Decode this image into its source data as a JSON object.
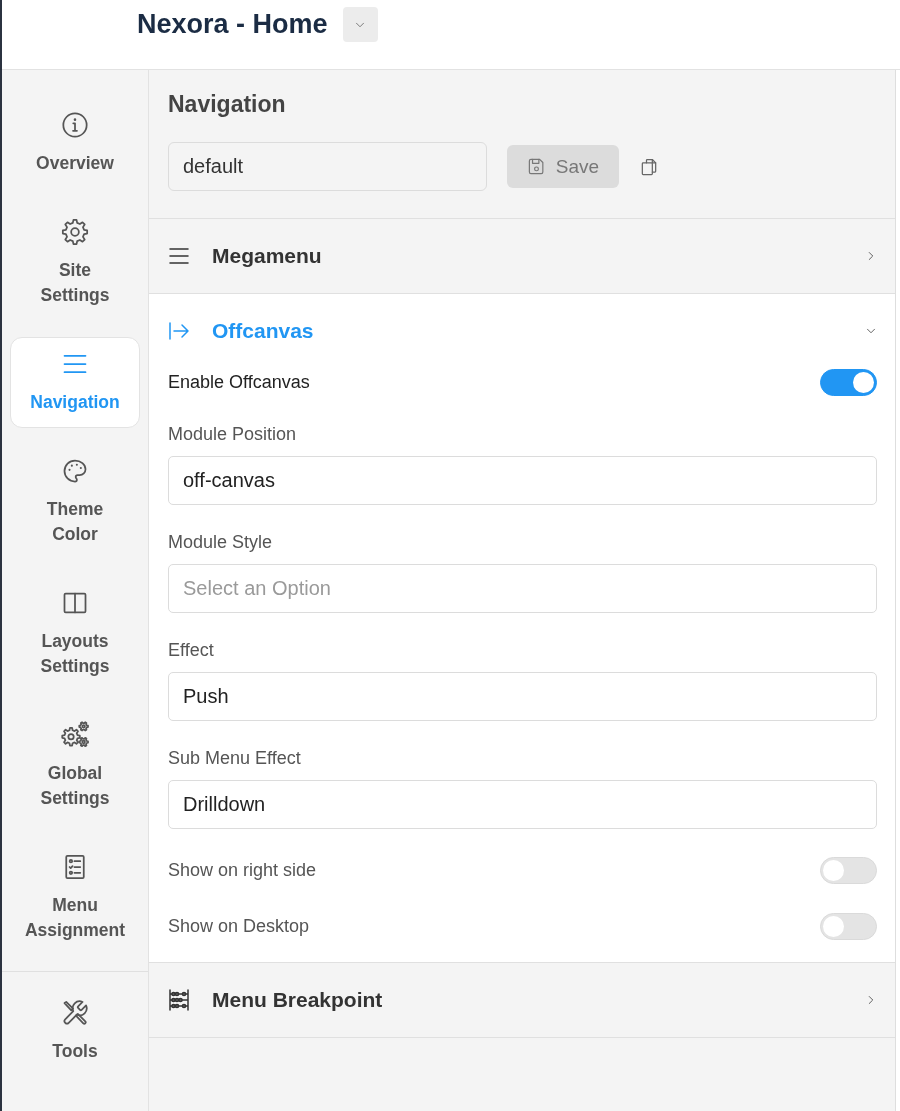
{
  "header": {
    "title": "Nexora - Home"
  },
  "sidebar": {
    "items": [
      {
        "label": "Overview",
        "selected": false
      },
      {
        "label": "Site Settings",
        "selected": false
      },
      {
        "label": "Navigation",
        "selected": true
      },
      {
        "label": "Theme Color",
        "selected": false
      },
      {
        "label": "Layouts Settings",
        "selected": false
      },
      {
        "label": "Global Settings",
        "selected": false
      },
      {
        "label": "Menu Assignment",
        "selected": false
      }
    ],
    "footer_items": [
      {
        "label": "Tools",
        "selected": false
      }
    ]
  },
  "panel": {
    "title": "Navigation",
    "preset": {
      "value": "default"
    },
    "save_button": {
      "label": "Save",
      "disabled": true
    }
  },
  "sections": [
    {
      "title": "Megamenu",
      "expanded": false
    },
    {
      "title": "Offcanvas",
      "expanded": true,
      "fields": [
        {
          "kind": "toggle",
          "label": "Enable Offcanvas",
          "on": true
        },
        {
          "kind": "input",
          "label": "Module Position",
          "value": "off-canvas"
        },
        {
          "kind": "input",
          "label": "Module Style",
          "placeholder": "Select an Option"
        },
        {
          "kind": "input",
          "label": "Effect",
          "value": "Push"
        },
        {
          "kind": "input",
          "label": "Sub Menu Effect",
          "value": "Drilldown"
        },
        {
          "kind": "toggle",
          "label": "Show on right side",
          "on": false
        },
        {
          "kind": "toggle",
          "label": "Show on Desktop",
          "on": false
        }
      ]
    },
    {
      "title": "Menu Breakpoint",
      "expanded": false
    }
  ]
}
